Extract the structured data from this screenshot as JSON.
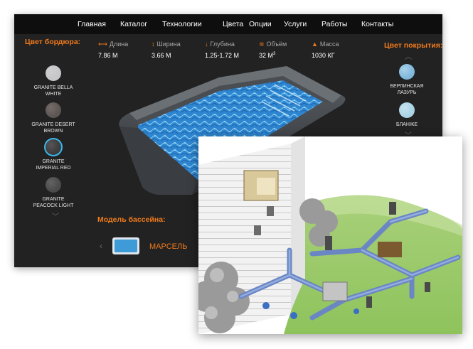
{
  "nav": {
    "items": [
      "Главная",
      "Каталог",
      "Технологии",
      "Цвета",
      "Опции",
      "Услуги",
      "Работы",
      "Контакты"
    ]
  },
  "border": {
    "title": "Цвет бордюра:",
    "swatches": [
      {
        "lines": [
          "GRANITE BELLA",
          "WHITE"
        ],
        "color": "#c7c7c9"
      },
      {
        "lines": [
          "GRANITE DESERT",
          "BROWN"
        ],
        "color": "#5e5652"
      },
      {
        "lines": [
          "GRANITE",
          "IMPERIAL RED"
        ],
        "color": "#3d3b3c"
      },
      {
        "lines": [
          "GRANITE",
          "PEACOCK LIGHT"
        ],
        "color": "#4b4b4b"
      }
    ],
    "selected_index": 2,
    "selected_ring_color": "#3bb8ec"
  },
  "stats": [
    {
      "icon": "length-icon",
      "glyph": "⟷",
      "label": "Длина",
      "value": "7.86 М"
    },
    {
      "icon": "width-icon",
      "glyph": "↕",
      "label": "Ширина",
      "value": "3.66 М"
    },
    {
      "icon": "depth-icon",
      "glyph": "↓",
      "label": "Глубина",
      "value": "1.25-1.72 М"
    },
    {
      "icon": "volume-icon",
      "glyph": "≋",
      "label": "Объём",
      "value": "32 М",
      "sup": "3"
    },
    {
      "icon": "weight-icon",
      "glyph": "▲",
      "label": "Масса",
      "value": "1030 КГ"
    }
  ],
  "coating": {
    "title": "Цвет покрытия:",
    "swatches": [
      {
        "lines": [
          "БЕРЛИНСКАЯ",
          "ЛАЗУРЬ"
        ],
        "color": "#7fb8dc"
      },
      {
        "lines": [
          "БЛАНЖЕ"
        ],
        "color": "#a9d4e7"
      }
    ]
  },
  "model": {
    "title": "Модель бассейна:",
    "name": "МАРСЕЛЬ"
  },
  "colors": {
    "accent": "#f07a1c",
    "nav_bg": "#0e0e0e",
    "panel_bg": "#222222",
    "water": "#2f86d0"
  }
}
